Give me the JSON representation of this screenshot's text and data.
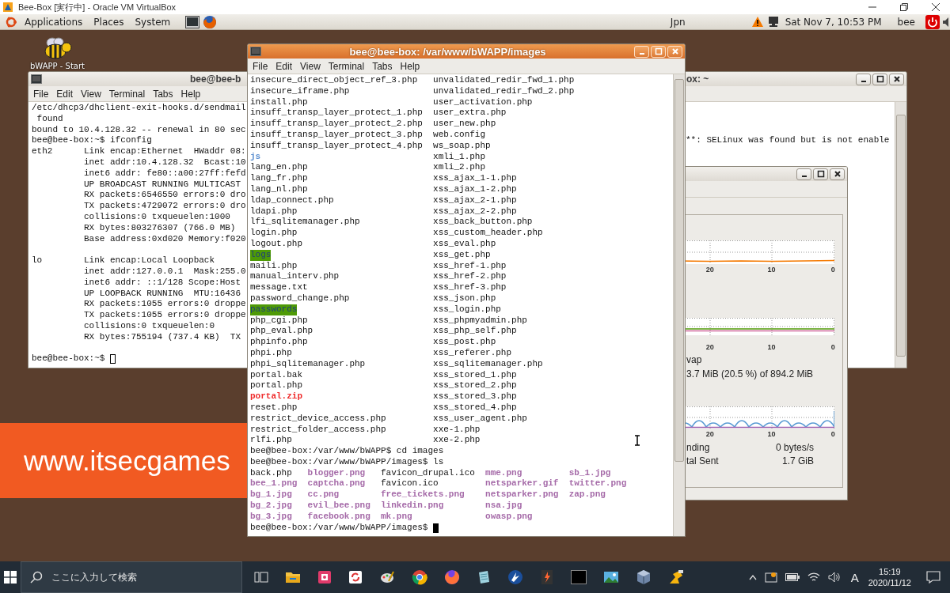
{
  "host_window": {
    "title": "Bee-Box [実行中] - Oracle VM VirtualBox"
  },
  "top_panel": {
    "menus": [
      "Applications",
      "Places",
      "System"
    ],
    "keyboard_layout": "Jpn",
    "clock": "Sat Nov  7, 10:53 PM",
    "user": "bee"
  },
  "desktop": {
    "icon_label": "bWAPP - Start",
    "banner": "www.itsecgames"
  },
  "left_terminal": {
    "title": "bee@bee-b",
    "menus": [
      "File",
      "Edit",
      "View",
      "Terminal",
      "Tabs",
      "Help"
    ],
    "cursor_focused": false,
    "blocks": [
      [
        "/etc/dhcp3/dhclient-exit-hooks.d/sendmail",
        " found",
        "bound to 10.4.128.32 -- renewal in 80 sec",
        "bee@bee-box:~$ ifconfig",
        "eth2      Link encap:Ethernet  HWaddr 08:",
        "          inet addr:10.4.128.32  Bcast:10",
        "          inet6 addr: fe80::a00:27ff:fefd",
        "          UP BROADCAST RUNNING MULTICAST",
        "          RX packets:6546550 errors:0 dro",
        "          TX packets:4729072 errors:0 dro",
        "          collisions:0 txqueuelen:1000",
        "          RX bytes:803276307 (766.0 MB)",
        "          Base address:0xd020 Memory:f020"
      ],
      [
        "lo        Link encap:Local Loopback",
        "          inet addr:127.0.0.1  Mask:255.0",
        "          inet6 addr: ::1/128 Scope:Host",
        "          UP LOOPBACK RUNNING  MTU:16436",
        "          RX packets:1055 errors:0 droppe",
        "          TX packets:1055 errors:0 droppe",
        "          collisions:0 txqueuelen:0",
        "          RX bytes:755194 (737.4 KB)  TX"
      ],
      [
        "bee@bee-box:~$"
      ]
    ]
  },
  "background_terminal": {
    "title": "ox: ~",
    "lines": [
      "**: SELinux was found but is not enable"
    ]
  },
  "system_monitor": {
    "sections": [
      {
        "kind": "cpu",
        "ticks": [
          "20",
          "10",
          "0"
        ]
      },
      {
        "kind": "memory",
        "ticks": [
          "20",
          "10",
          "0"
        ],
        "label": "vap",
        "detail": "3.7 MiB (20.5 %) of 894.2 MiB"
      },
      {
        "kind": "network",
        "ticks": [
          "20",
          "10",
          "0"
        ],
        "stats": [
          {
            "label": "nding",
            "value": "0 bytes/s"
          },
          {
            "label": "tal Sent",
            "value": "1.7 GiB"
          }
        ]
      }
    ]
  },
  "main_terminal": {
    "title": "bee@bee-box: /var/www/bWAPP/images",
    "menus": [
      "File",
      "Edit",
      "View",
      "Terminal",
      "Tabs",
      "Help"
    ],
    "cursor_focused": true,
    "blocks": [
      {
        "kind": "listing",
        "rows": [
          [
            {
              "name": "insecure_direct_object_ref_3.php",
              "kind": "file"
            },
            {
              "name": "unvalidated_redir_fwd_1.php",
              "kind": "file"
            }
          ],
          [
            {
              "name": "insecure_iframe.php",
              "kind": "file"
            },
            {
              "name": "unvalidated_redir_fwd_2.php",
              "kind": "file"
            }
          ],
          [
            {
              "name": "install.php",
              "kind": "file"
            },
            {
              "name": "user_activation.php",
              "kind": "file"
            }
          ],
          [
            {
              "name": "insuff_transp_layer_protect_1.php",
              "kind": "file"
            },
            {
              "name": "user_extra.php",
              "kind": "file"
            }
          ],
          [
            {
              "name": "insuff_transp_layer_protect_2.php",
              "kind": "file"
            },
            {
              "name": "user_new.php",
              "kind": "file"
            }
          ],
          [
            {
              "name": "insuff_transp_layer_protect_3.php",
              "kind": "file"
            },
            {
              "name": "web.config",
              "kind": "file"
            }
          ],
          [
            {
              "name": "insuff_transp_layer_protect_4.php",
              "kind": "file"
            },
            {
              "name": "ws_soap.php",
              "kind": "file"
            }
          ],
          [
            {
              "name": "js",
              "kind": "dir"
            },
            {
              "name": "xmli_1.php",
              "kind": "file"
            }
          ],
          [
            {
              "name": "lang_en.php",
              "kind": "file"
            },
            {
              "name": "xmli_2.php",
              "kind": "file"
            }
          ],
          [
            {
              "name": "lang_fr.php",
              "kind": "file"
            },
            {
              "name": "xss_ajax_1-1.php",
              "kind": "file"
            }
          ],
          [
            {
              "name": "lang_nl.php",
              "kind": "file"
            },
            {
              "name": "xss_ajax_1-2.php",
              "kind": "file"
            }
          ],
          [
            {
              "name": "ldap_connect.php",
              "kind": "file"
            },
            {
              "name": "xss_ajax_2-1.php",
              "kind": "file"
            }
          ],
          [
            {
              "name": "ldapi.php",
              "kind": "file"
            },
            {
              "name": "xss_ajax_2-2.php",
              "kind": "file"
            }
          ],
          [
            {
              "name": "lfi_sqlitemanager.php",
              "kind": "file"
            },
            {
              "name": "xss_back_button.php",
              "kind": "file"
            }
          ],
          [
            {
              "name": "login.php",
              "kind": "file"
            },
            {
              "name": "xss_custom_header.php",
              "kind": "file"
            }
          ],
          [
            {
              "name": "logout.php",
              "kind": "file"
            },
            {
              "name": "xss_eval.php",
              "kind": "file"
            }
          ],
          [
            {
              "name": "logs",
              "kind": "sticky_dir"
            },
            {
              "name": "xss_get.php",
              "kind": "file"
            }
          ],
          [
            {
              "name": "maili.php",
              "kind": "file"
            },
            {
              "name": "xss_href-1.php",
              "kind": "file"
            }
          ],
          [
            {
              "name": "manual_interv.php",
              "kind": "file"
            },
            {
              "name": "xss_href-2.php",
              "kind": "file"
            }
          ],
          [
            {
              "name": "message.txt",
              "kind": "file"
            },
            {
              "name": "xss_href-3.php",
              "kind": "file"
            }
          ],
          [
            {
              "name": "password_change.php",
              "kind": "file"
            },
            {
              "name": "xss_json.php",
              "kind": "file"
            }
          ],
          [
            {
              "name": "passwords",
              "kind": "sticky_dir"
            },
            {
              "name": "xss_login.php",
              "kind": "file"
            }
          ],
          [
            {
              "name": "php_cgi.php",
              "kind": "file"
            },
            {
              "name": "xss_phpmyadmin.php",
              "kind": "file"
            }
          ],
          [
            {
              "name": "php_eval.php",
              "kind": "file"
            },
            {
              "name": "xss_php_self.php",
              "kind": "file"
            }
          ],
          [
            {
              "name": "phpinfo.php",
              "kind": "file"
            },
            {
              "name": "xss_post.php",
              "kind": "file"
            }
          ],
          [
            {
              "name": "phpi.php",
              "kind": "file"
            },
            {
              "name": "xss_referer.php",
              "kind": "file"
            }
          ],
          [
            {
              "name": "phpi_sqlitemanager.php",
              "kind": "file"
            },
            {
              "name": "xss_sqlitemanager.php",
              "kind": "file"
            }
          ],
          [
            {
              "name": "portal.bak",
              "kind": "file"
            },
            {
              "name": "xss_stored_1.php",
              "kind": "file"
            }
          ],
          [
            {
              "name": "portal.php",
              "kind": "file"
            },
            {
              "name": "xss_stored_2.php",
              "kind": "file"
            }
          ],
          [
            {
              "name": "portal.zip",
              "kind": "archive"
            },
            {
              "name": "xss_stored_3.php",
              "kind": "file"
            }
          ],
          [
            {
              "name": "reset.php",
              "kind": "file"
            },
            {
              "name": "xss_stored_4.php",
              "kind": "file"
            }
          ],
          [
            {
              "name": "restrict_device_access.php",
              "kind": "file"
            },
            {
              "name": "xss_user_agent.php",
              "kind": "file"
            }
          ],
          [
            {
              "name": "restrict_folder_access.php",
              "kind": "file"
            },
            {
              "name": "xxe-1.php",
              "kind": "file"
            }
          ],
          [
            {
              "name": "rlfi.php",
              "kind": "file"
            },
            {
              "name": "xxe-2.php",
              "kind": "file"
            }
          ]
        ]
      },
      {
        "kind": "prompt",
        "text": "bee@bee-box:/var/www/bWAPP$ cd images"
      },
      {
        "kind": "prompt",
        "text": "bee@bee-box:/var/www/bWAPP/images$ ls"
      },
      {
        "kind": "listing",
        "rows": [
          [
            {
              "name": "back.php",
              "kind": "file"
            },
            {
              "name": "blogger.png",
              "kind": "image"
            },
            {
              "name": "favicon_drupal.ico",
              "kind": "file"
            },
            {
              "name": "mme.png",
              "kind": "image"
            },
            {
              "name": "sb_1.jpg",
              "kind": "image"
            }
          ],
          [
            {
              "name": "bee_1.png",
              "kind": "image"
            },
            {
              "name": "captcha.png",
              "kind": "image"
            },
            {
              "name": "favicon.ico",
              "kind": "file"
            },
            {
              "name": "netsparker.gif",
              "kind": "image"
            },
            {
              "name": "twitter.png",
              "kind": "image"
            }
          ],
          [
            {
              "name": "bg_1.jpg",
              "kind": "image"
            },
            {
              "name": "cc.png",
              "kind": "image"
            },
            {
              "name": "free_tickets.png",
              "kind": "image"
            },
            {
              "name": "netsparker.png",
              "kind": "image"
            },
            {
              "name": "zap.png",
              "kind": "image"
            }
          ],
          [
            {
              "name": "bg_2.jpg",
              "kind": "image"
            },
            {
              "name": "evil_bee.png",
              "kind": "image"
            },
            {
              "name": "linkedin.png",
              "kind": "image"
            },
            {
              "name": "nsa.jpg",
              "kind": "image"
            }
          ],
          [
            {
              "name": "bg_3.jpg",
              "kind": "image"
            },
            {
              "name": "facebook.png",
              "kind": "image"
            },
            {
              "name": "mk.png",
              "kind": "image"
            },
            {
              "name": "owasp.png",
              "kind": "image"
            }
          ]
        ]
      },
      {
        "kind": "prompt",
        "text": "bee@bee-box:/var/www/bWAPP/images$"
      }
    ]
  },
  "taskbar": {
    "search": {
      "placeholder": "ここに入力して検索"
    },
    "input_mode": "A",
    "time": "15:19",
    "date": "2020/11/12"
  }
}
